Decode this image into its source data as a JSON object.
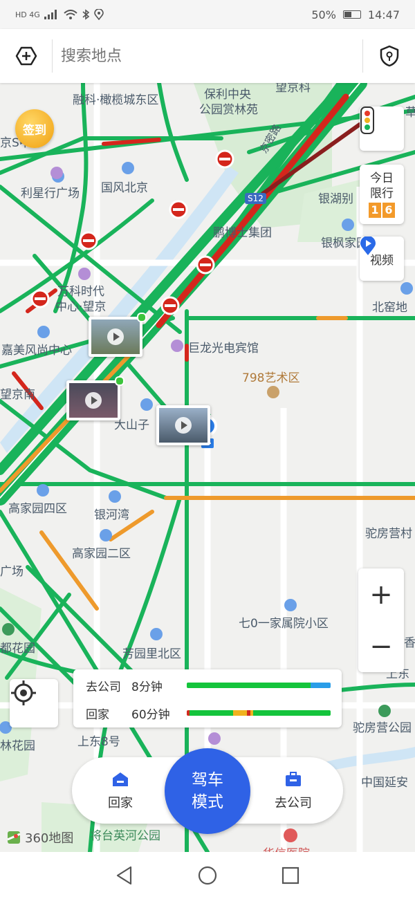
{
  "status_bar": {
    "battery_text": "50%",
    "time": "14:47",
    "signal_text": "HD 4G",
    "battery_level": 0.5
  },
  "search": {
    "placeholder": "搜索地点"
  },
  "map": {
    "poi_labels": [
      {
        "text": "融科·橄榄城东区",
        "style": "gray"
      },
      {
        "text": "保利中央",
        "style": "gray"
      },
      {
        "text": "公园赏林苑",
        "style": "gray"
      },
      {
        "text": "望京科",
        "style": "gray"
      },
      {
        "text": "京S中心",
        "style": "gray"
      },
      {
        "text": "京密路",
        "style": "gray"
      },
      {
        "text": "利星行广场",
        "style": "gray"
      },
      {
        "text": "国风北京",
        "style": "gray"
      },
      {
        "text": "银湖别",
        "style": "gray"
      },
      {
        "text": "S12",
        "style": "gray"
      },
      {
        "text": "鹏博士集团",
        "style": "gray"
      },
      {
        "text": "银枫家园",
        "style": "gray"
      },
      {
        "text": "万科时代",
        "style": "gray"
      },
      {
        "text": "中心·望京",
        "style": "gray"
      },
      {
        "text": "北窑地",
        "style": "gray"
      },
      {
        "text": "嘉美风尚中心",
        "style": "gray"
      },
      {
        "text": "巨龙光电宾馆",
        "style": "gray"
      },
      {
        "text": "798艺术区",
        "style": "orange"
      },
      {
        "text": "望京南",
        "style": "gray"
      },
      {
        "text": "大山子",
        "style": "gray"
      },
      {
        "text": "高家园四区",
        "style": "gray"
      },
      {
        "text": "银河湾",
        "style": "gray"
      },
      {
        "text": "驼房营村",
        "style": "gray"
      },
      {
        "text": "高家园二区",
        "style": "gray"
      },
      {
        "text": "广场",
        "style": "gray"
      },
      {
        "text": "七0一家属院小区",
        "style": "gray"
      },
      {
        "text": "都花园",
        "style": "gray"
      },
      {
        "text": "芳园里北区",
        "style": "gray"
      },
      {
        "text": "上东",
        "style": "gray"
      },
      {
        "text": "香",
        "style": "gray"
      },
      {
        "text": "驼房营公园",
        "style": "gray"
      },
      {
        "text": "林花园",
        "style": "gray"
      },
      {
        "text": "上东8号",
        "style": "gray"
      },
      {
        "text": "中国延安",
        "style": "gray"
      },
      {
        "text": "将台英河公园",
        "style": "green"
      },
      {
        "text": "华信医院",
        "style": "gray"
      },
      {
        "text": "草",
        "style": "gray"
      }
    ],
    "sign_in": "签到",
    "traffic_light_icon": "traffic-light-icon",
    "restriction": {
      "title_line1": "今日",
      "title_line2": "限行",
      "digits": [
        "1",
        "6"
      ]
    },
    "video_label": "视频",
    "zoom_in": "+",
    "zoom_out": "−"
  },
  "eta": {
    "rows": [
      {
        "label": "去公司",
        "time": "8分钟",
        "segments": [
          {
            "color": "#14c43c",
            "frac": 0.86
          },
          {
            "color": "#2a9de8",
            "frac": 0.14
          }
        ]
      },
      {
        "label": "回家",
        "time": "60分钟",
        "segments": [
          {
            "color": "#d22a1e",
            "frac": 0.02
          },
          {
            "color": "#14c43c",
            "frac": 0.3
          },
          {
            "color": "#f0b21e",
            "frac": 0.1
          },
          {
            "color": "#d22a1e",
            "frac": 0.02
          },
          {
            "color": "#f0b21e",
            "frac": 0.02
          },
          {
            "color": "#14c43c",
            "frac": 0.54
          }
        ]
      }
    ]
  },
  "bottom": {
    "home_label": "回家",
    "drive_line1": "驾车",
    "drive_line2": "模式",
    "company_label": "去公司"
  },
  "logo_text": "360地图",
  "colors": {
    "road_green": "#19b35a",
    "road_red": "#d4261c",
    "road_orange": "#ee9a2c",
    "accent_blue": "#2f62e6"
  }
}
